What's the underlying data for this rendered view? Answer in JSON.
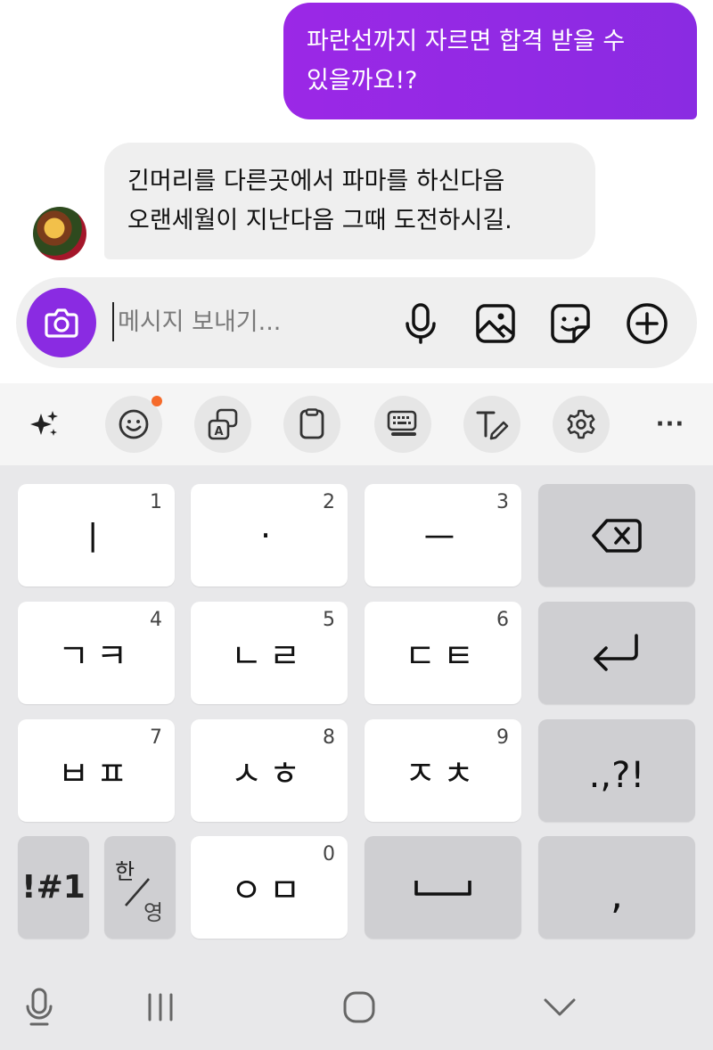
{
  "chat": {
    "outgoing": {
      "line1": "파란선까지 자르면 합격 받을 수",
      "line2": "있을까요!?"
    },
    "incoming": {
      "line1": "긴머리를 다른곳에서 파마를 하신다음",
      "line2": "오랜세월이 지난다음 그때 도전하시길."
    },
    "accent": "#8a2be2"
  },
  "composer": {
    "placeholder": "메시지 보내기...",
    "icons": [
      "camera-icon",
      "microphone-icon",
      "image-icon",
      "sticker-icon",
      "add-icon"
    ]
  },
  "toolbar": {
    "icons": [
      "ai-sparkle-icon",
      "emoji-icon",
      "translate-icon",
      "clipboard-icon",
      "keyboard-mode-icon",
      "text-style-icon",
      "settings-icon",
      "more-icon"
    ],
    "more_label": "···",
    "notification_color": "#f56a2a"
  },
  "keyboard": {
    "row1": [
      {
        "label": "ㅣ",
        "num": "1"
      },
      {
        "label": "·",
        "num": "2"
      },
      {
        "label": "ㅡ",
        "num": "3"
      }
    ],
    "row2": [
      {
        "label": "ㄱㅋ",
        "num": "4"
      },
      {
        "label": "ㄴㄹ",
        "num": "5"
      },
      {
        "label": "ㄷㅌ",
        "num": "6"
      }
    ],
    "row3": [
      {
        "label": "ㅂㅍ",
        "num": "7"
      },
      {
        "label": "ㅅㅎ",
        "num": "8"
      },
      {
        "label": "ㅈㅊ",
        "num": "9"
      }
    ],
    "row4": [
      {
        "label": "ㅇㅁ",
        "num": "0"
      }
    ],
    "symbols_label": "!#1",
    "lang_top": "한",
    "lang_bottom": "영",
    "punct_label": ".,?!",
    "comma_label": ","
  },
  "navbar": {
    "icons": [
      "keyboard-voice-icon",
      "recent-apps-icon",
      "home-icon",
      "hide-keyboard-icon"
    ]
  }
}
